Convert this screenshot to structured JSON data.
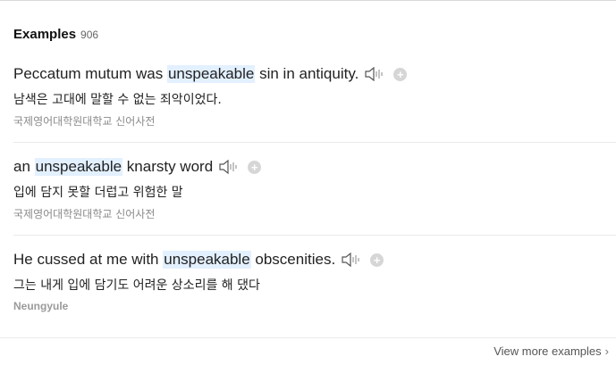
{
  "section": {
    "title": "Examples",
    "count": "906"
  },
  "examples": [
    {
      "en_before": "Peccatum mutum was ",
      "en_highlight": "unspeakable",
      "en_after": " sin in antiquity.",
      "ko": "남색은 고대에 말할 수 없는 죄악이었다.",
      "source": "국제영어대학원대학교 신어사전"
    },
    {
      "en_before": "an ",
      "en_highlight": "unspeakable",
      "en_after": " knarsty word",
      "ko": "입에 담지 못할 더럽고 위험한 말",
      "source": "국제영어대학원대학교 신어사전"
    },
    {
      "en_before": "He cussed at me with ",
      "en_highlight": "unspeakable",
      "en_after": " obscenities.",
      "ko": "그는 내게 입에 담기도 어려운 상소리를 해 댔다",
      "source": "Neungyule"
    }
  ],
  "icons": {
    "speaker": "speaker-icon",
    "add": "add-icon",
    "chevron": "chevron-right-icon"
  },
  "add_symbol": "+",
  "view_more": {
    "label": "View more examples",
    "chevron": "›"
  },
  "colors": {
    "highlight": "#e3f0ff",
    "muted": "#8a8a8a"
  }
}
